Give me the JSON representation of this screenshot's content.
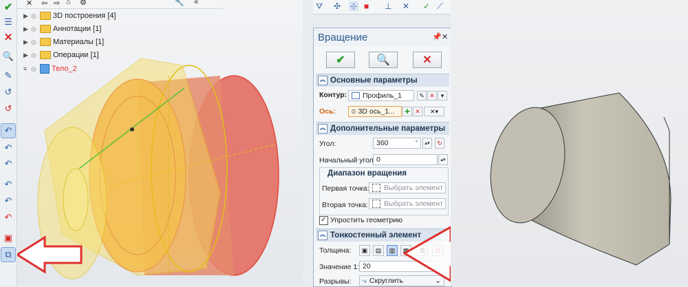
{
  "toolbar": {
    "checkmark_icon": "check-icon",
    "close_icon": "close-icon"
  },
  "tree": {
    "items": [
      {
        "label": "3D построения [4]",
        "icon": "folder-icon"
      },
      {
        "label": "Аннотации [1]",
        "icon": "folder-icon"
      },
      {
        "label": "Материалы [1]",
        "icon": "folder-icon"
      },
      {
        "label": "Операции [1]",
        "icon": "folder-icon"
      },
      {
        "label": "Тело_2",
        "icon": "body-icon",
        "color": "#e32b2b"
      }
    ]
  },
  "dialog": {
    "title": "Вращение",
    "sections": {
      "main": "Основные параметры",
      "extra": "Дополнительные параметры",
      "thin": "Тонкостенный элемент"
    },
    "contour_label": "Контур:",
    "contour_value": "Профиль_1",
    "axis_label": "Ось:",
    "axis_value": "3D ось_1...",
    "angle_label": "Угол:",
    "angle_value": "360",
    "angle_unit": "°",
    "start_angle_label": "Начальный угол:",
    "start_angle_value": "0",
    "range_title": "Диапазон вращения",
    "first_point_label": "Первая точка:",
    "second_point_label": "Вторая точка:",
    "select_placeholder": "Выбрать элемент",
    "simplify_label": "Упростить геометрию",
    "simplify_checked": true,
    "thickness_label": "Толщина:",
    "value1_label": "Значение 1:",
    "value1_value": "20",
    "breaks_label": "Разрывы:",
    "breaks_value": "Скруглить"
  },
  "colors": {
    "accent": "#2c5a8e",
    "ok_green": "#2e9e2e",
    "cancel_red": "#d62828",
    "arrow_red": "#e0302e",
    "preview_yellow": "#f3d23a",
    "preview_orange": "#f2a13a",
    "preview_red": "#e06a5e"
  }
}
